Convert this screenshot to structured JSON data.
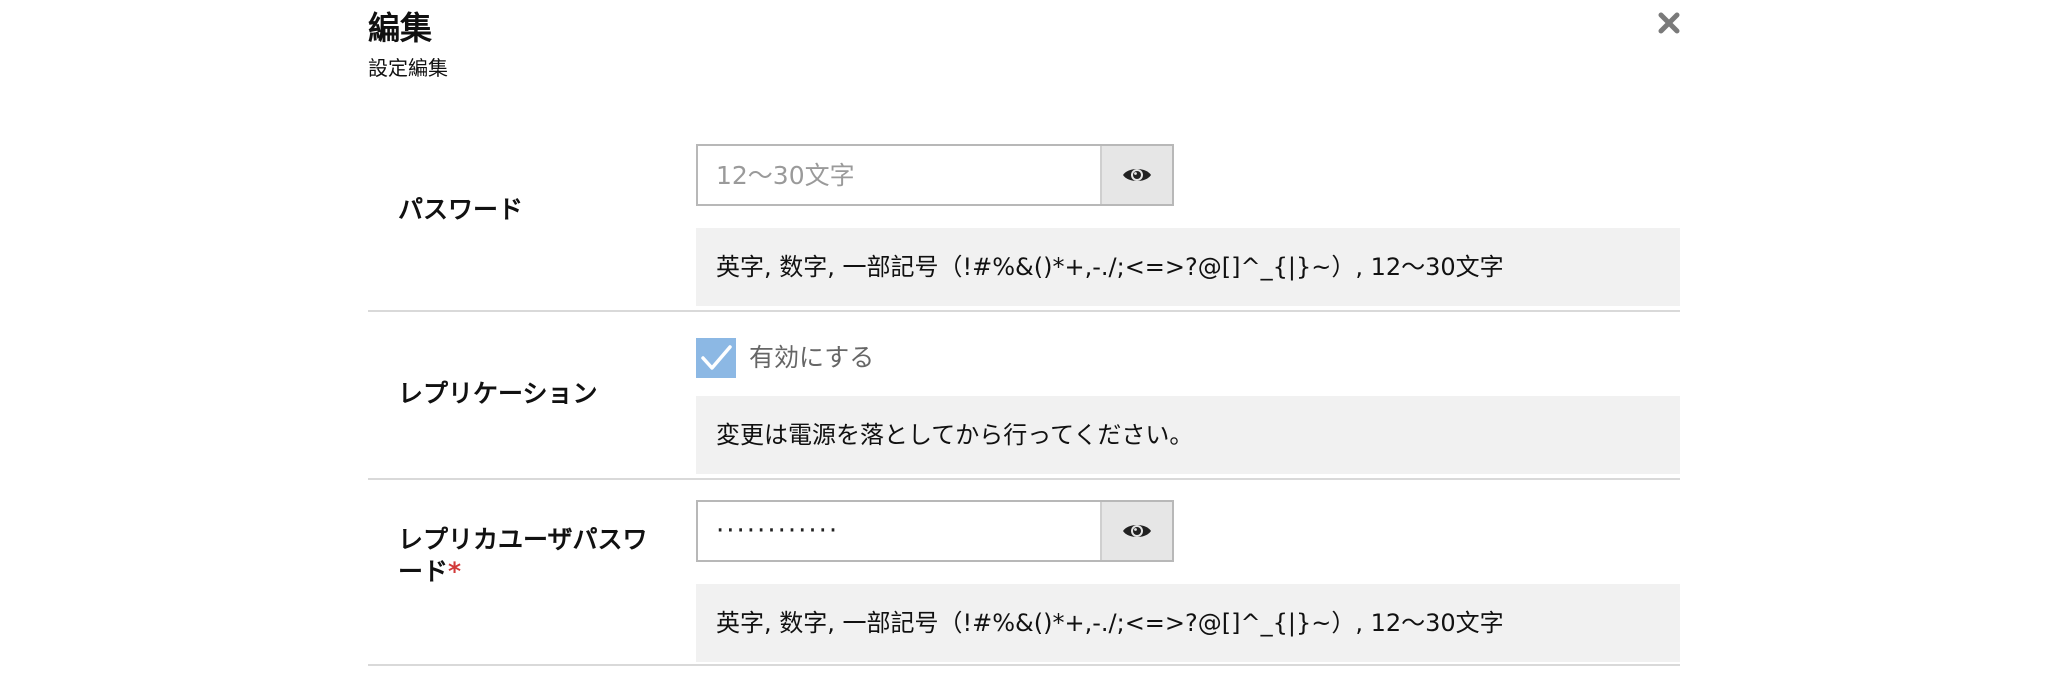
{
  "header": {
    "title": "編集",
    "subtitle": "設定編集",
    "close_icon": "close-icon"
  },
  "fields": {
    "password": {
      "label": "パスワード",
      "placeholder": "12〜30文字",
      "value": "",
      "toggle_icon": "eye-icon",
      "note": "英字, 数字, 一部記号（!#%&()*+,-./;<=>?@[]^_{|}~）, 12〜30文字"
    },
    "replication": {
      "label": "レプリケーション",
      "checkbox_label": "有効にする",
      "checked": true,
      "note": "変更は電源を落としてから行ってください。"
    },
    "replica_user_password": {
      "label": "レプリカユーザパスワード",
      "required_mark": "*",
      "masked_value": "············",
      "toggle_icon": "eye-icon",
      "note": "英字, 数字, 一部記号（!#%&()*+,-./;<=>?@[]^_{|}~）, 12〜30文字"
    }
  },
  "colors": {
    "checkbox_accent": "#8cb8e4",
    "required": "#d23a3a",
    "note_background": "#f1f1f1"
  }
}
